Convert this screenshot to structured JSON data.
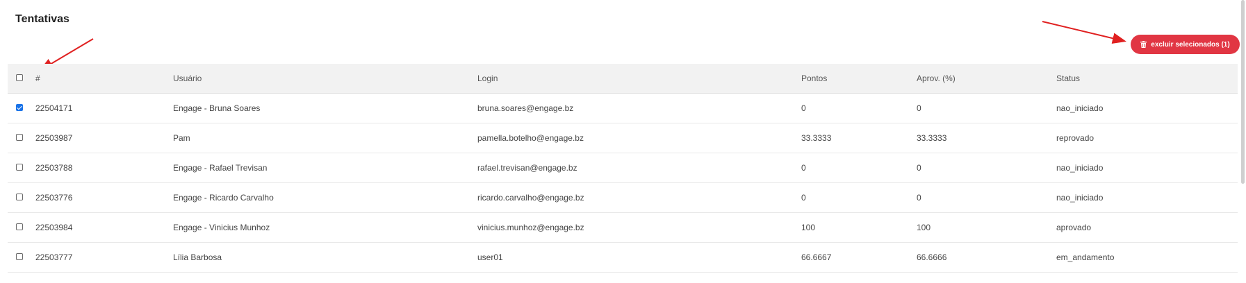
{
  "page": {
    "title": "Tentativas"
  },
  "toolbar": {
    "delete_label": "excluir selecionados (1)"
  },
  "table": {
    "headers": {
      "id": "#",
      "user": "Usuário",
      "login": "Login",
      "points": "Pontos",
      "aprov": "Aprov. (%)",
      "status": "Status"
    },
    "rows": [
      {
        "checked": true,
        "id": "22504171",
        "user": "Engage - Bruna Soares",
        "login": "bruna.soares@engage.bz",
        "points": "0",
        "aprov": "0",
        "status": "nao_iniciado"
      },
      {
        "checked": false,
        "id": "22503987",
        "user": "Pam",
        "login": "pamella.botelho@engage.bz",
        "points": "33.3333",
        "aprov": "33.3333",
        "status": "reprovado"
      },
      {
        "checked": false,
        "id": "22503788",
        "user": "Engage - Rafael Trevisan",
        "login": "rafael.trevisan@engage.bz",
        "points": "0",
        "aprov": "0",
        "status": "nao_iniciado"
      },
      {
        "checked": false,
        "id": "22503776",
        "user": "Engage - Ricardo Carvalho",
        "login": "ricardo.carvalho@engage.bz",
        "points": "0",
        "aprov": "0",
        "status": "nao_iniciado"
      },
      {
        "checked": false,
        "id": "22503984",
        "user": "Engage - Vinicius Munhoz",
        "login": "vinicius.munhoz@engage.bz",
        "points": "100",
        "aprov": "100",
        "status": "aprovado"
      },
      {
        "checked": false,
        "id": "22503777",
        "user": "Lília Barbosa",
        "login": "user01",
        "points": "66.6667",
        "aprov": "66.6666",
        "status": "em_andamento"
      }
    ]
  },
  "colors": {
    "accent": "#e13643",
    "annotation_arrow": "#e02020",
    "checkbox_checked": "#1a73e8"
  },
  "icons": {
    "delete": "trash-icon"
  }
}
